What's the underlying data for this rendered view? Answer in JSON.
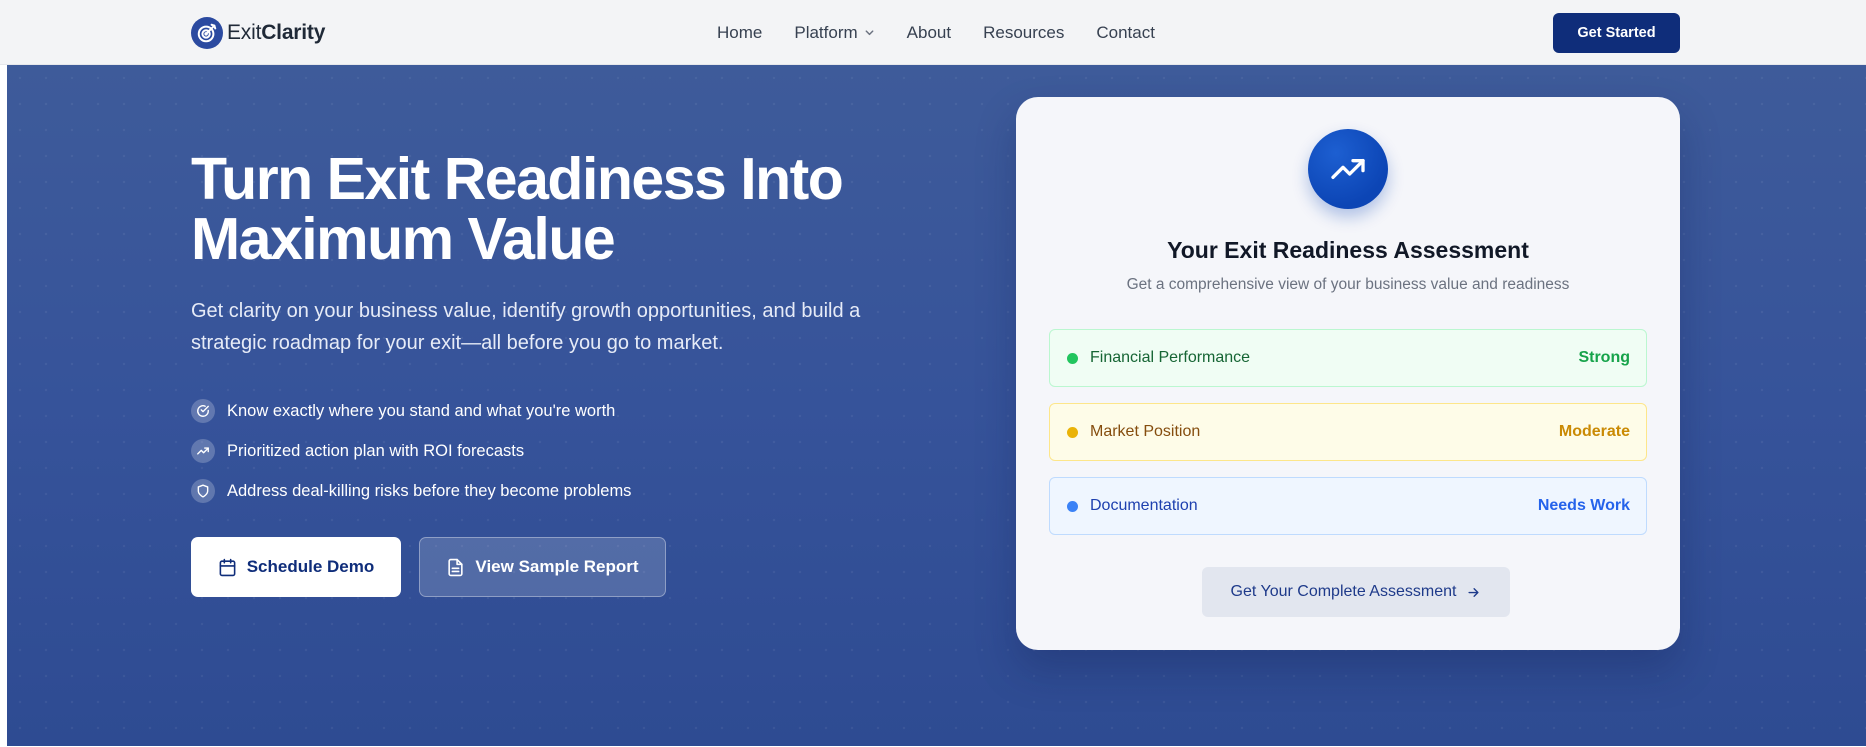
{
  "brand": {
    "name_prefix": "Exit",
    "name_suffix": "Clarity"
  },
  "nav": {
    "links": [
      "Home",
      "Platform",
      "About",
      "Resources",
      "Contact"
    ],
    "cta": "Get Started"
  },
  "hero": {
    "headline_line1": "Turn Exit Readiness Into",
    "headline_line2": "Maximum Value",
    "subtext": "Get clarity on your business value, identify growth opportunities, and build a strategic roadmap for your exit—all before you go to market.",
    "features": [
      {
        "icon": "check-circle-icon",
        "text": "Know exactly where you stand and what you're worth"
      },
      {
        "icon": "trending-up-icon",
        "text": "Prioritized action plan with ROI forecasts"
      },
      {
        "icon": "shield-icon",
        "text": "Address deal-killing risks before they become problems"
      }
    ],
    "primary_button": "Schedule Demo",
    "secondary_button": "View Sample Report"
  },
  "assessment_card": {
    "icon": "trending-up-icon",
    "title": "Your Exit Readiness Assessment",
    "subtitle": "Get a comprehensive view of your business value and readiness",
    "rows": [
      {
        "label": "Financial Performance",
        "status": "Strong",
        "color": "#22c55e"
      },
      {
        "label": "Market Position",
        "status": "Moderate",
        "color": "#eab308"
      },
      {
        "label": "Documentation",
        "status": "Needs Work",
        "color": "#3b82f6"
      }
    ],
    "cta": "Get Your Complete Assessment"
  },
  "colors": {
    "brand_navy": "#0f2d7a",
    "hero_background": "#3a5697",
    "card_background": "#f5f6fa"
  }
}
